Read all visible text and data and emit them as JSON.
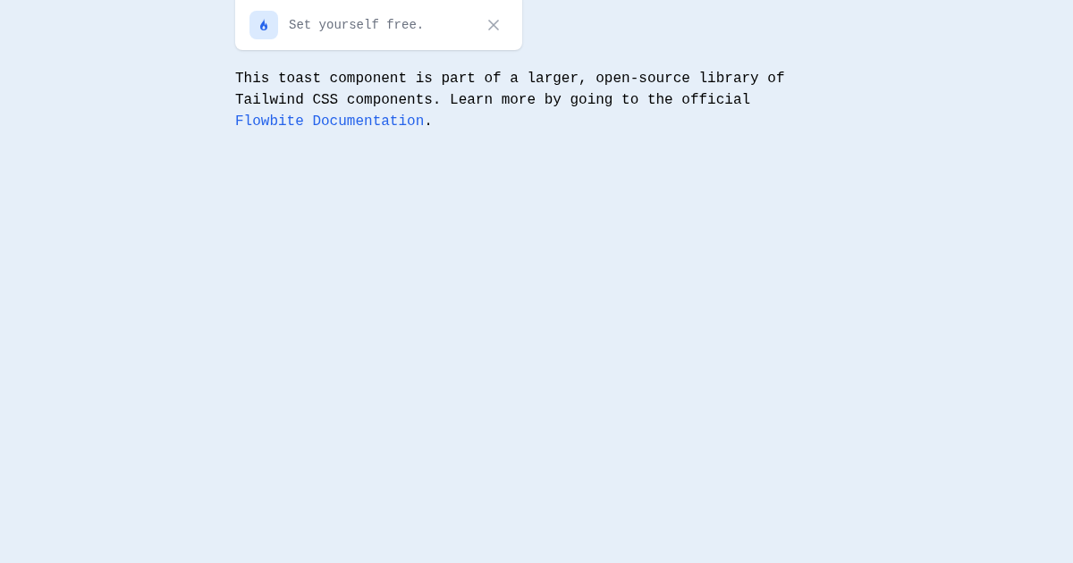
{
  "toast": {
    "message": "Set yourself free."
  },
  "description": {
    "text": "This toast component is part of a larger, open-source library of Tailwind CSS components. Learn more by going to the official ",
    "link": "Flowbite Documentation",
    "after": "."
  }
}
